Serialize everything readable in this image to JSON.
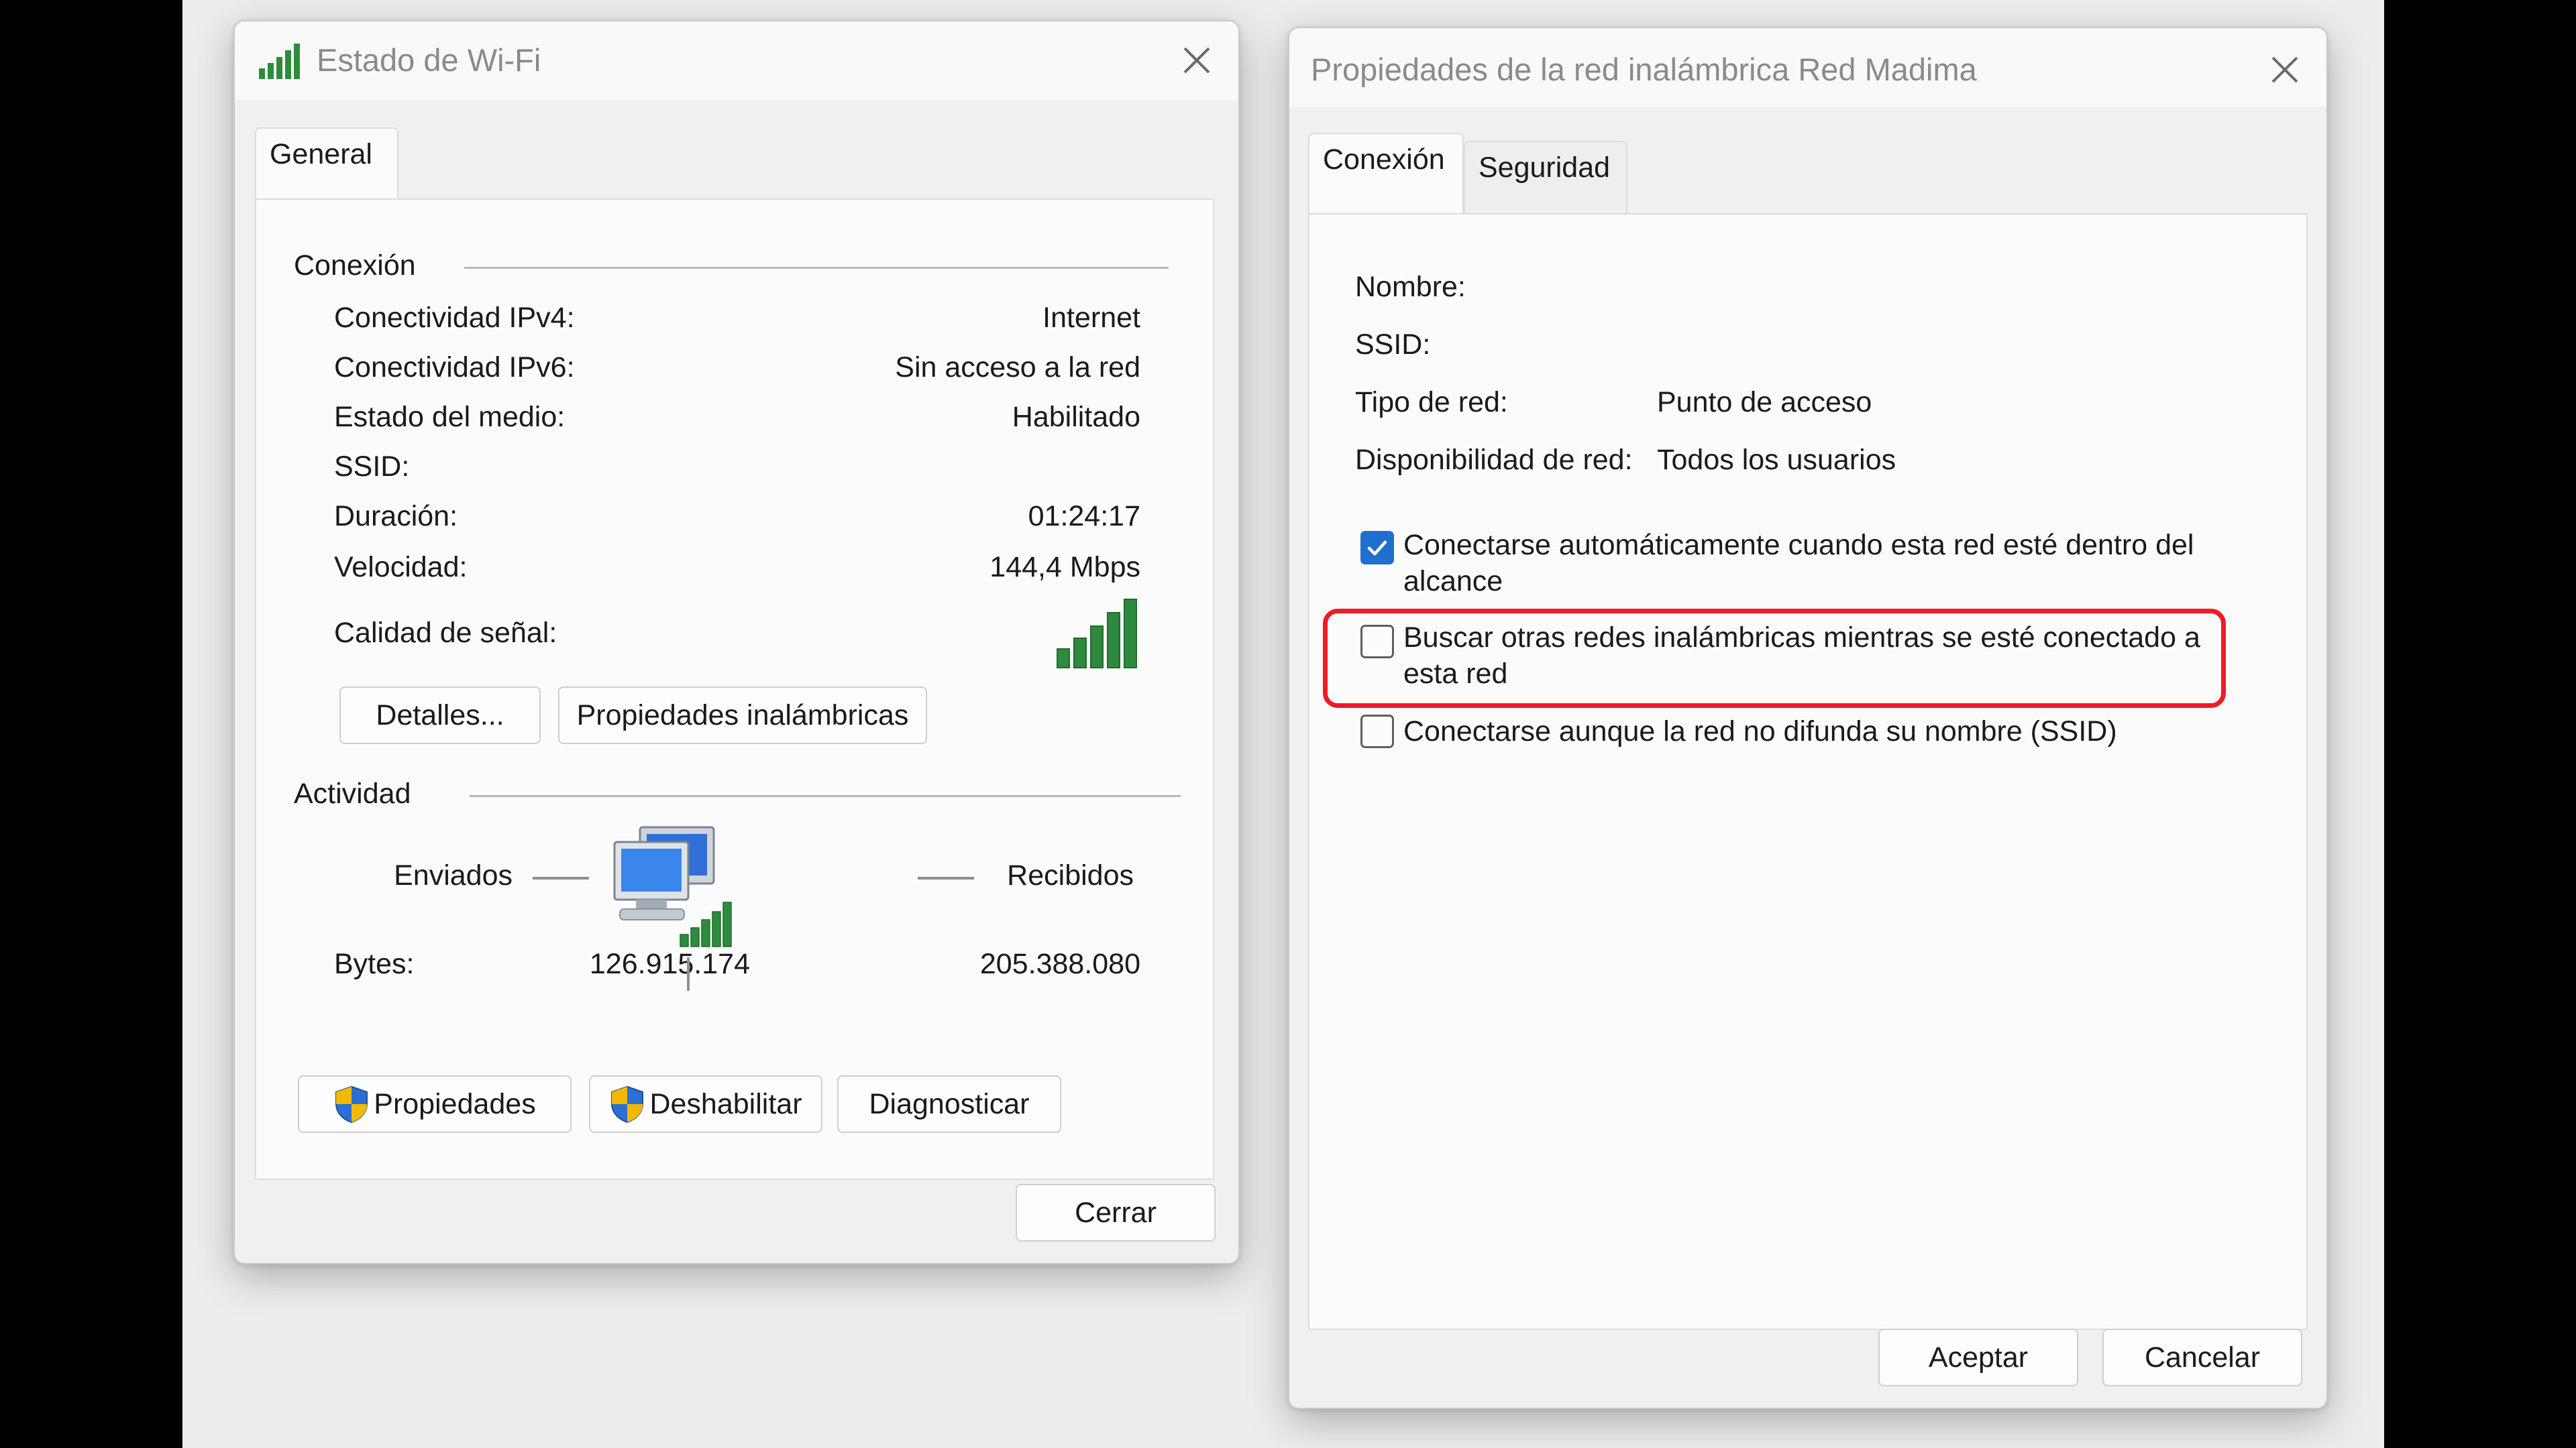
{
  "wifi_status": {
    "title": "Estado de Wi-Fi",
    "tab_general": "General",
    "connection_section": "Conexión",
    "rows": [
      {
        "label": "Conectividad IPv4:",
        "value": "Internet"
      },
      {
        "label": "Conectividad IPv6:",
        "value": "Sin acceso a la red"
      },
      {
        "label": "Estado del medio:",
        "value": "Habilitado"
      },
      {
        "label": "SSID:",
        "value": ""
      },
      {
        "label": "Duración:",
        "value": "01:24:17"
      },
      {
        "label": "Velocidad:",
        "value": "144,4 Mbps"
      }
    ],
    "signal_label": "Calidad de señal:",
    "signal_bars": 5,
    "details_button": "Detalles...",
    "wireless_props_button": "Propiedades inalámbricas",
    "activity_section": "Actividad",
    "sent_label": "Enviados",
    "received_label": "Recibidos",
    "bytes_label": "Bytes:",
    "bytes_sent": "126.915.174",
    "bytes_received": "205.388.080",
    "properties_button": "Propiedades",
    "disable_button": "Deshabilitar",
    "diagnose_button": "Diagnosticar",
    "close_button": "Cerrar"
  },
  "wireless_props": {
    "title": "Propiedades de la red inalámbrica Red Madima",
    "tab_connection": "Conexión",
    "tab_security": "Seguridad",
    "name_label": "Nombre:",
    "name_value": "",
    "ssid_label": "SSID:",
    "ssid_value": "",
    "network_type_label": "Tipo de red:",
    "network_type_value": "Punto de acceso",
    "availability_label": "Disponibilidad de red:",
    "availability_value": "Todos los usuarios",
    "checkboxes": [
      {
        "label": "Conectarse automáticamente cuando esta red esté dentro del alcance",
        "checked": true
      },
      {
        "label": "Buscar otras redes inalámbricas mientras se esté conectado a esta red",
        "checked": false,
        "highlighted": true
      },
      {
        "label": "Conectarse aunque la red no difunda su nombre (SSID)",
        "checked": false
      }
    ],
    "accept_button": "Aceptar",
    "cancel_button": "Cancelar"
  },
  "colors": {
    "checkbox_checked": "#1e6fd0",
    "highlight": "#ee1b24",
    "signal_green": "#2e8b3e"
  }
}
